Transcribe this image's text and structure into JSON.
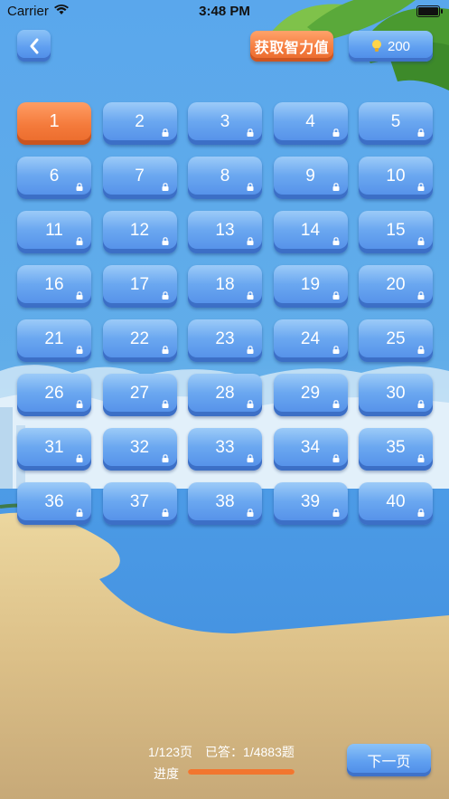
{
  "status_bar": {
    "carrier": "Carrier",
    "time": "3:48 PM"
  },
  "header": {
    "back_icon": "chevron-left-icon",
    "get_points_label": "获取智力值",
    "points_icon": "lightbulb-icon",
    "points_value": "200"
  },
  "levels": {
    "active_index": 0,
    "items": [
      {
        "label": "1",
        "locked": false
      },
      {
        "label": "2",
        "locked": true
      },
      {
        "label": "3",
        "locked": true
      },
      {
        "label": "4",
        "locked": true
      },
      {
        "label": "5",
        "locked": true
      },
      {
        "label": "6",
        "locked": true
      },
      {
        "label": "7",
        "locked": true
      },
      {
        "label": "8",
        "locked": true
      },
      {
        "label": "9",
        "locked": true
      },
      {
        "label": "10",
        "locked": true
      },
      {
        "label": "11",
        "locked": true
      },
      {
        "label": "12",
        "locked": true
      },
      {
        "label": "13",
        "locked": true
      },
      {
        "label": "14",
        "locked": true
      },
      {
        "label": "15",
        "locked": true
      },
      {
        "label": "16",
        "locked": true
      },
      {
        "label": "17",
        "locked": true
      },
      {
        "label": "18",
        "locked": true
      },
      {
        "label": "19",
        "locked": true
      },
      {
        "label": "20",
        "locked": true
      },
      {
        "label": "21",
        "locked": true
      },
      {
        "label": "22",
        "locked": true
      },
      {
        "label": "23",
        "locked": true
      },
      {
        "label": "24",
        "locked": true
      },
      {
        "label": "25",
        "locked": true
      },
      {
        "label": "26",
        "locked": true
      },
      {
        "label": "27",
        "locked": true
      },
      {
        "label": "28",
        "locked": true
      },
      {
        "label": "29",
        "locked": true
      },
      {
        "label": "30",
        "locked": true
      },
      {
        "label": "31",
        "locked": true
      },
      {
        "label": "32",
        "locked": true
      },
      {
        "label": "33",
        "locked": true
      },
      {
        "label": "34",
        "locked": true
      },
      {
        "label": "35",
        "locked": true
      },
      {
        "label": "36",
        "locked": true
      },
      {
        "label": "37",
        "locked": true
      },
      {
        "label": "38",
        "locked": true
      },
      {
        "label": "39",
        "locked": true
      },
      {
        "label": "40",
        "locked": true
      }
    ]
  },
  "footer": {
    "page_text": "1/123页",
    "answered_text": "已答：1/4883题",
    "progress_label": "进度",
    "progress_fraction": 1.0,
    "next_label": "下一页"
  },
  "colors": {
    "accent_orange": "#f47a3d",
    "tile_blue": "#5f9ff0",
    "sky_blue": "#5aa7ec",
    "sand": "#e3c88f"
  }
}
